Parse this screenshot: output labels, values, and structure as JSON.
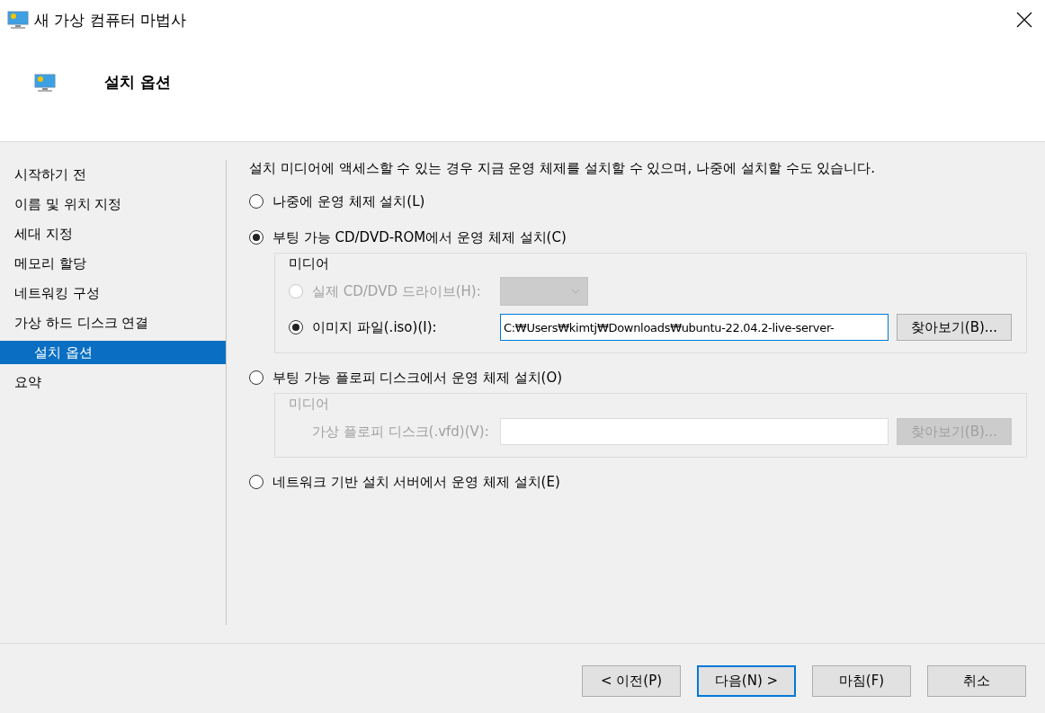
{
  "window": {
    "title": "새 가상 컴퓨터 마법사"
  },
  "header": {
    "title": "설치 옵션"
  },
  "sidebar": {
    "items": [
      {
        "label": "시작하기 전",
        "selected": false
      },
      {
        "label": "이름 및 위치 지정",
        "selected": false
      },
      {
        "label": "세대 지정",
        "selected": false
      },
      {
        "label": "메모리 할당",
        "selected": false
      },
      {
        "label": "네트워킹 구성",
        "selected": false
      },
      {
        "label": "가상 하드 디스크 연결",
        "selected": false
      },
      {
        "label": "설치 옵션",
        "selected": true
      },
      {
        "label": "요약",
        "selected": false
      }
    ]
  },
  "description": "설치 미디어에 액세스할 수 있는 경우 지금 운영 체제를 설치할 수 있으며, 나중에 설치할 수도 있습니다.",
  "options": [
    {
      "label": "나중에 운영 체제 설치(L)",
      "selected": false
    },
    {
      "label": "부팅 가능 CD/DVD-ROM에서 운영 체제 설치(C)",
      "selected": true,
      "media": {
        "legend": "미디어",
        "disabled": false,
        "rows": [
          {
            "kind": "radio",
            "label": "실제 CD/DVD 드라이브(H):",
            "selected": false,
            "disabled": true
          },
          {
            "kind": "radio",
            "label": "이미지 파일(.iso)(I):",
            "selected": true,
            "disabled": false,
            "value": "C:₩Users₩kimtj₩Downloads₩ubuntu-22.04.2-live-server-",
            "browse": "찾아보기(B)..."
          }
        ]
      }
    },
    {
      "label": "부팅 가능 플로피 디스크에서 운영 체제 설치(O)",
      "selected": false,
      "media": {
        "legend": "미디어",
        "disabled": true,
        "rows": [
          {
            "kind": "label",
            "label": "가상 플로피 디스크(.vfd)(V):",
            "disabled": true,
            "browse": "찾아보기(B)..."
          }
        ]
      }
    },
    {
      "label": "네트워크 기반 설치 서버에서 운영 체제 설치(E)",
      "selected": false
    }
  ],
  "buttons": [
    {
      "label": "< 이전(P)",
      "default": false
    },
    {
      "label": "다음(N) >",
      "default": true
    },
    {
      "label": "마침(F)",
      "default": false
    },
    {
      "label": "취소",
      "default": false
    }
  ]
}
